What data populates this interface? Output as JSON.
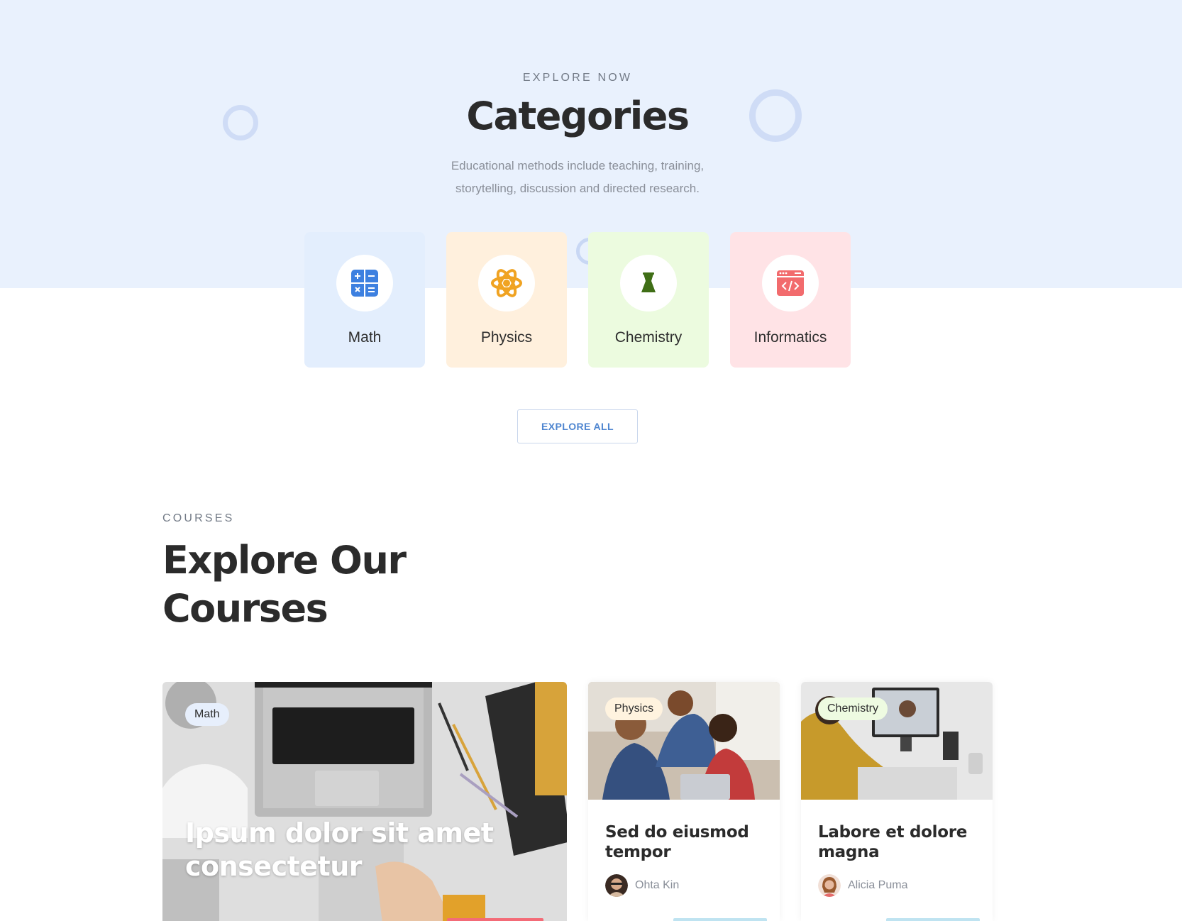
{
  "categories_section": {
    "eyebrow": "EXPLORE NOW",
    "title": "Categories",
    "description_line1": "Educational methods include teaching, training,",
    "description_line2": "storytelling, discussion and directed research.",
    "items": [
      {
        "label": "Math",
        "icon": "calculator-icon",
        "bg": "#e3eefd"
      },
      {
        "label": "Physics",
        "icon": "atom-icon",
        "bg": "#fff0dd"
      },
      {
        "label": "Chemistry",
        "icon": "flask-icon",
        "bg": "#ecfbdf"
      },
      {
        "label": "Informatics",
        "icon": "code-window-icon",
        "bg": "#ffe3e6"
      }
    ],
    "explore_button": "EXPLORE ALL"
  },
  "courses_section": {
    "eyebrow": "COURSES",
    "title_line1": "Explore Our",
    "title_line2": "Courses",
    "courses": [
      {
        "tag": "Math",
        "title": "Ipsum dolor sit amet consectetur",
        "tag_bg": "#e7effc"
      },
      {
        "tag": "Physics",
        "title": "Sed do eiusmod tempor",
        "author": "Ohta Kin",
        "tag_bg": "#fff3df"
      },
      {
        "tag": "Chemistry",
        "title": "Labore et dolore magna",
        "author": "Alicia Puma",
        "tag_bg": "#eefbe1"
      }
    ]
  },
  "colors": {
    "hero_bg": "#e9f1fd",
    "accent_blue": "#4f86d0",
    "heading": "#2b2b2b",
    "muted": "#8a8f99"
  }
}
